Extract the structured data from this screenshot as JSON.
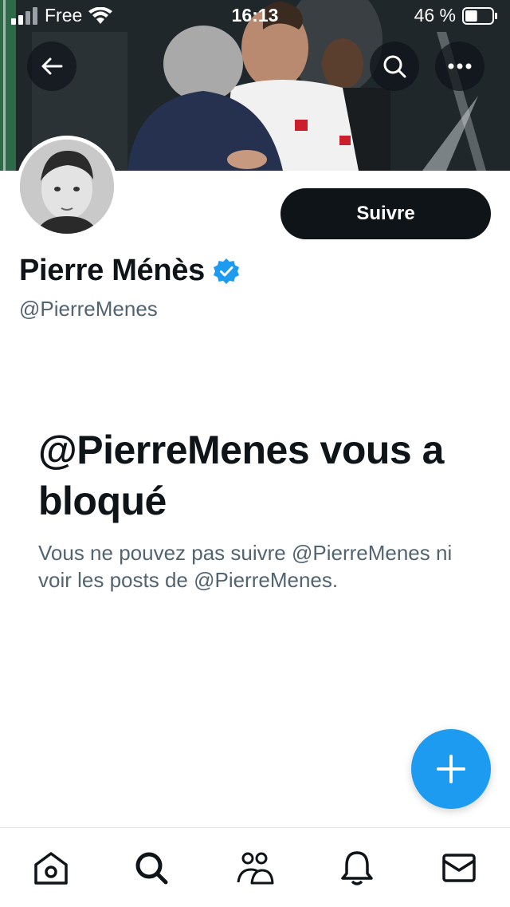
{
  "status_bar": {
    "carrier": "Free",
    "time": "16:13",
    "battery": "46 %",
    "battery_level": 0.46
  },
  "header": {
    "back_icon": "arrow-left-icon",
    "search_icon": "search-icon",
    "more_icon": "more-horizontal-icon"
  },
  "profile": {
    "display_name": "Pierre Ménès",
    "verified_icon": "verified-badge-icon",
    "verified_color": "#1d9bf0",
    "handle": "@PierreMenes",
    "follow_label": "Suivre"
  },
  "blocked": {
    "title": "@PierreMenes vous a bloqué",
    "description": "Vous ne pouvez pas suivre @PierreMenes ni voir les posts de @PierreMenes."
  },
  "fab": {
    "icon": "plus-icon",
    "color": "#1d9bf0"
  },
  "tabbar": {
    "items": [
      {
        "name": "home",
        "icon": "home-icon"
      },
      {
        "name": "search",
        "icon": "search-icon"
      },
      {
        "name": "communities",
        "icon": "communities-icon"
      },
      {
        "name": "notifications",
        "icon": "bell-icon"
      },
      {
        "name": "messages",
        "icon": "mail-icon"
      }
    ]
  }
}
